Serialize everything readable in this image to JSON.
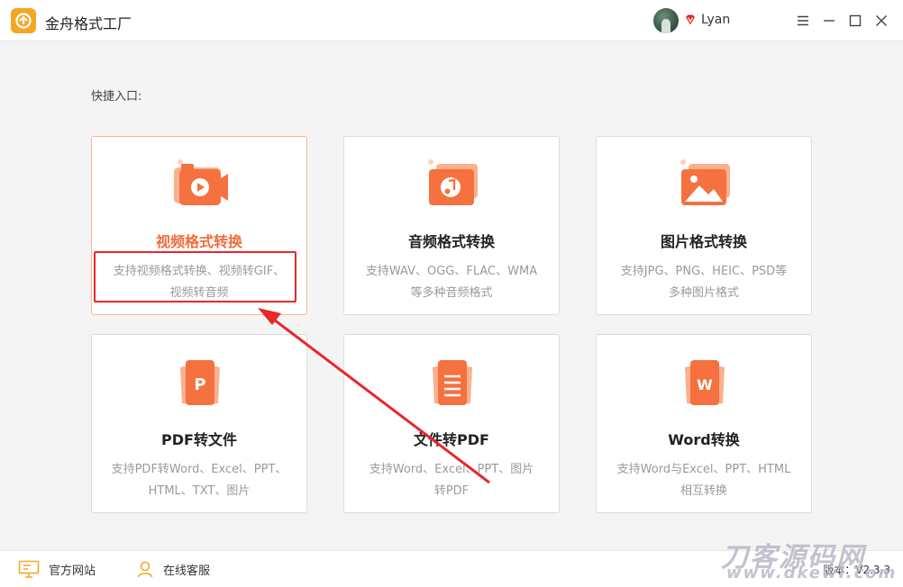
{
  "app": {
    "title": "金舟格式工厂",
    "user_name": "Lyan"
  },
  "main": {
    "section_label": "快捷入口:",
    "cards": [
      {
        "title": "视频格式转换",
        "desc_line1": "支持视频格式转换、视频转GIF、",
        "desc_line2": "视频转音频"
      },
      {
        "title": "音频格式转换",
        "desc_line1": "支持WAV、OGG、FLAC、WMA",
        "desc_line2": "等多种音频格式"
      },
      {
        "title": "图片格式转换",
        "desc_line1": "支持JPG、PNG、HEIC、PSD等",
        "desc_line2": "多种图片格式"
      },
      {
        "title": "PDF转文件",
        "desc_line1": "支持PDF转Word、Excel、PPT、",
        "desc_line2": "HTML、TXT、图片"
      },
      {
        "title": "文件转PDF",
        "desc_line1": "支持Word、Excel、PPT、图片",
        "desc_line2": "转PDF"
      },
      {
        "title": "Word转换",
        "desc_line1": "支持Word与Excel、PPT、HTML",
        "desc_line2": "相互转换"
      }
    ],
    "card_icon_letters": {
      "pdf": "P",
      "word": "W"
    }
  },
  "footer": {
    "website_label": "官方网站",
    "support_label": "在线客服",
    "version_label": "版本：V2.3.3"
  },
  "watermark": {
    "text": "刀客源码网",
    "sub": "www.dkewl.com"
  },
  "colors": {
    "accent": "#f26b3a",
    "icon_orange": "#f5713f",
    "icon_light": "#fbb08e",
    "annotation_red": "#e8262b",
    "logo_yellow": "#f5a623"
  },
  "icons": [
    "app-logo-icon",
    "vip-diamond-icon",
    "menu-icon",
    "minimize-icon",
    "maximize-icon",
    "close-icon",
    "video-icon",
    "audio-icon",
    "image-icon",
    "pdf-icon",
    "document-icon",
    "word-icon",
    "monitor-icon",
    "headset-person-icon"
  ]
}
